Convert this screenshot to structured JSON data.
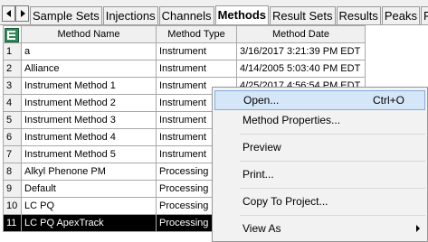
{
  "tabs": [
    "Sample Sets",
    "Injections",
    "Channels",
    "Methods",
    "Result Sets",
    "Results",
    "Peaks",
    "Fra"
  ],
  "active_tab": "Methods",
  "table": {
    "columns": [
      "Method Name",
      "Method Type",
      "Method Date"
    ],
    "rows": [
      {
        "num": "1",
        "name": "a",
        "type": "Instrument",
        "date": "3/16/2017 3:21:39 PM EDT"
      },
      {
        "num": "2",
        "name": "Alliance",
        "type": "Instrument",
        "date": "4/14/2005 5:03:40 PM EDT"
      },
      {
        "num": "3",
        "name": "Instrument Method 1",
        "type": "Instrument",
        "date": "4/25/2017 4:56:54 PM EDT"
      },
      {
        "num": "4",
        "name": "Instrument Method 2",
        "type": "Instrument",
        "date": ""
      },
      {
        "num": "5",
        "name": "Instrument Method 3",
        "type": "Instrument",
        "date": ""
      },
      {
        "num": "6",
        "name": "Instrument Method 4",
        "type": "Instrument",
        "date": ""
      },
      {
        "num": "7",
        "name": "Instrument Method 5",
        "type": "Instrument",
        "date": ""
      },
      {
        "num": "8",
        "name": "Alkyl Phenone PM",
        "type": "Processing",
        "date": ""
      },
      {
        "num": "9",
        "name": "Default",
        "type": "Processing",
        "date": ""
      },
      {
        "num": "10",
        "name": "LC PQ",
        "type": "Processing",
        "date": ""
      },
      {
        "num": "11",
        "name": "LC PQ ApexTrack",
        "type": "Processing",
        "date": ""
      }
    ]
  },
  "context_menu": {
    "open": {
      "label": "Open...",
      "shortcut": "Ctrl+O"
    },
    "method_properties": "Method Properties...",
    "preview": "Preview",
    "print": "Print...",
    "copy_to_project": "Copy To Project...",
    "view_as": "View As"
  },
  "colors": {
    "selected_row_bg": "#000000",
    "menu_highlight_bg": "#d5e6f8",
    "menu_highlight_border": "#84acdd"
  }
}
